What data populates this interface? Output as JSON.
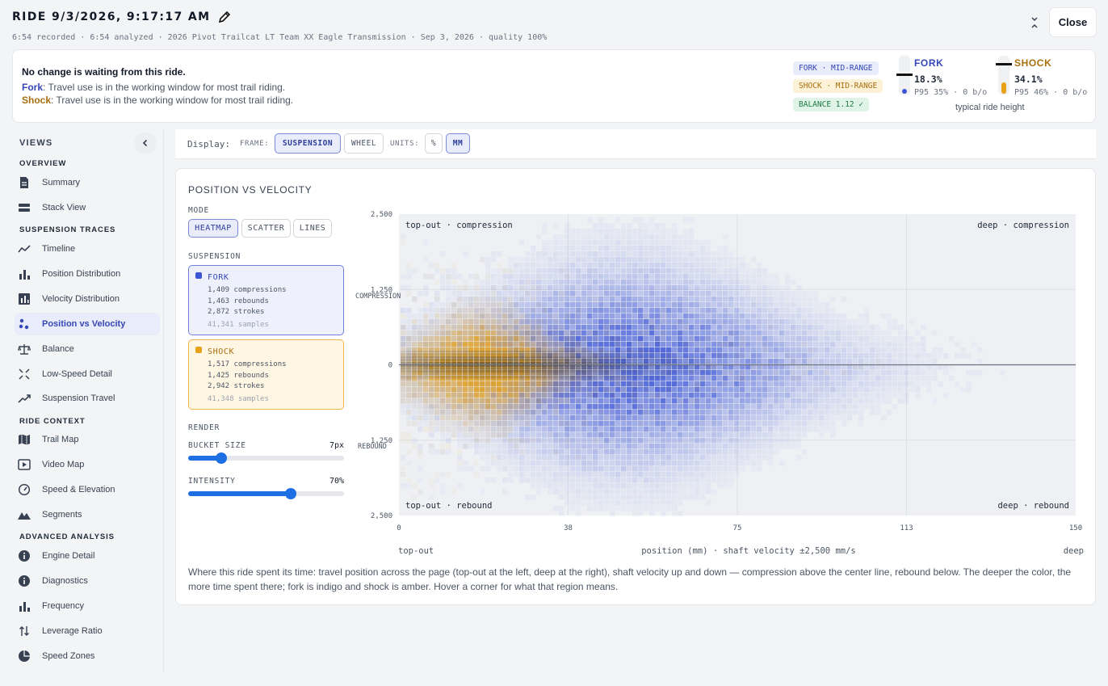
{
  "header": {
    "title": "RIDE 9/3/2026, 9:17:17 AM",
    "subtitle": "6:54 recorded · 6:54 analyzed · 2026 Pivot Trailcat LT Team XX Eagle Transmission · Sep 3, 2026 · quality 100%",
    "close_label": "Close"
  },
  "status": {
    "message": "No change is waiting from this ride.",
    "fork_label": "Fork",
    "fork_text": ": Travel use is in the working window for most trail riding.",
    "shock_label": "Shock",
    "shock_text": ": Travel use is in the working window for most trail riding.",
    "fork_pill": "FORK · MID-RANGE",
    "shock_pill": "SHOCK · MID-RANGE",
    "balance_pill": "BALANCE 1.12 ✓",
    "fork": {
      "name": "FORK",
      "pct": "18.3%",
      "p95": "P95 35% · 0 b/o",
      "level": 0.183
    },
    "shock": {
      "name": "SHOCK",
      "pct": "34.1%",
      "p95": "P95 46% · 0 b/o",
      "level": 0.341
    },
    "typical": "typical ride height",
    "colors": {
      "fork": "#3b55d6",
      "shock": "#e8a21a",
      "fork_text": "#3447b5",
      "shock_text": "#a86f0d",
      "balance_bg": "#dff3e6",
      "balance_text": "#1f7a46"
    }
  },
  "sidebar": {
    "title": "VIEWS",
    "sections": [
      {
        "title": "OVERVIEW",
        "items": [
          {
            "label": "Summary",
            "icon": "document-icon"
          },
          {
            "label": "Stack View",
            "icon": "stack-icon"
          }
        ]
      },
      {
        "title": "SUSPENSION TRACES",
        "items": [
          {
            "label": "Timeline",
            "icon": "line-trend-icon"
          },
          {
            "label": "Position Distribution",
            "icon": "bar-chart-icon"
          },
          {
            "label": "Velocity Distribution",
            "icon": "bar-box-icon"
          },
          {
            "label": "Position vs Velocity",
            "icon": "scatter-icon",
            "active": true
          },
          {
            "label": "Balance",
            "icon": "scale-icon"
          },
          {
            "label": "Low-Speed Detail",
            "icon": "compress-icon"
          },
          {
            "label": "Suspension Travel",
            "icon": "trend-up-icon"
          }
        ]
      },
      {
        "title": "RIDE CONTEXT",
        "items": [
          {
            "label": "Trail Map",
            "icon": "map-icon"
          },
          {
            "label": "Video Map",
            "icon": "video-icon"
          },
          {
            "label": "Speed & Elevation",
            "icon": "gauge-icon"
          },
          {
            "label": "Segments",
            "icon": "mountain-icon"
          }
        ]
      },
      {
        "title": "ADVANCED ANALYSIS",
        "items": [
          {
            "label": "Engine Detail",
            "icon": "info-icon"
          },
          {
            "label": "Diagnostics",
            "icon": "info-icon"
          },
          {
            "label": "Frequency",
            "icon": "bar-chart-icon"
          },
          {
            "label": "Leverage Ratio",
            "icon": "arrows-updown-icon"
          },
          {
            "label": "Speed Zones",
            "icon": "pie-icon"
          }
        ]
      }
    ]
  },
  "display": {
    "label": "Display:",
    "frame_label": "FRAME:",
    "frame_options": [
      "SUSPENSION",
      "WHEEL"
    ],
    "frame_selected": "SUSPENSION",
    "units_label": "UNITS:",
    "unit_options": [
      "%",
      "MM"
    ],
    "unit_selected": "MM"
  },
  "panel": {
    "title": "POSITION VS VELOCITY",
    "mode_label": "MODE",
    "modes": [
      "HEATMAP",
      "SCATTER",
      "LINES"
    ],
    "mode_selected": "HEATMAP",
    "suspension_label": "SUSPENSION",
    "fork": {
      "name": "FORK",
      "compressions": "1,409 compressions",
      "rebounds": "1,463 rebounds",
      "strokes": "2,872 strokes",
      "samples": "41,341 samples"
    },
    "shock": {
      "name": "SHOCK",
      "compressions": "1,517 compressions",
      "rebounds": "1,425 rebounds",
      "strokes": "2,942 strokes",
      "samples": "41,348 samples"
    },
    "render_label": "RENDER",
    "bucket": {
      "label": "BUCKET SIZE",
      "value_text": "7px",
      "fraction": 0.21
    },
    "intensity": {
      "label": "INTENSITY",
      "value_text": "70%",
      "fraction": 0.66
    },
    "description": "Where this ride spent its time: travel position across the page (top-out at the left, deep at the right), shaft velocity up and down — compression above the center line, rebound below. The deeper the color, the more time spent there; fork is indigo and shock is amber. Hover a corner for what that region means."
  },
  "chart_data": {
    "type": "heatmap",
    "x": {
      "min": 0,
      "max": 150,
      "ticks": [
        "0",
        "38",
        "75",
        "113",
        "150"
      ],
      "tick_values": [
        0,
        37.5,
        75,
        112.5,
        150
      ]
    },
    "y": {
      "min": -2500,
      "max": 2500,
      "ticks": [
        "2,500",
        "1,250",
        "0",
        "1,250",
        "2,500"
      ],
      "tick_values": [
        2500,
        1250,
        0,
        -1250,
        -2500
      ]
    },
    "compression_label": "COMPRESSION",
    "rebound_label": "REBOUND",
    "corners": {
      "tl": "top-out · compression",
      "tr": "deep · compression",
      "bl": "top-out · rebound",
      "br": "deep · rebound"
    },
    "xlabel_left": "top-out",
    "xlabel": "position (mm) · shaft velocity ±2,500 mm/s",
    "xlabel_right": "deep",
    "series": [
      {
        "name": "FORK",
        "color": "#3b55d6",
        "center_mm": 50,
        "spread_mm": 28,
        "vel_spread": 600
      },
      {
        "name": "SHOCK",
        "color": "#e8a21a",
        "center_mm": 18,
        "spread_mm": 12,
        "vel_spread": 300
      }
    ],
    "grid": true
  }
}
